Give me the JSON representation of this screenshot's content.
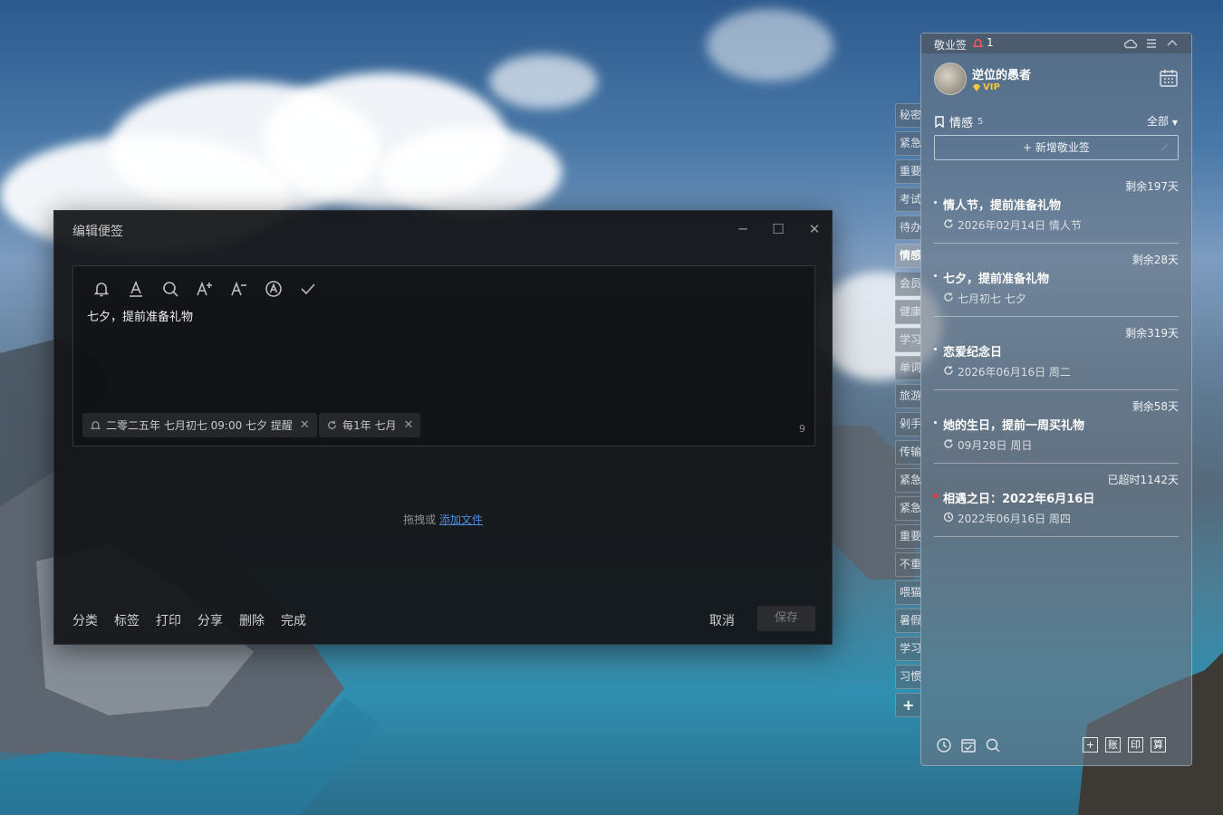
{
  "editor": {
    "title": "编辑便签",
    "note_text": "七夕，提前准备礼物",
    "reminder_chip": "二零二五年 七月初七 09:00 七夕 提醒",
    "repeat_chip": "每1年 七月",
    "char_count": "9",
    "drop_prefix": "拖拽或",
    "drop_link": "添加文件",
    "actions": [
      "分类",
      "标签",
      "打印",
      "分享",
      "删除",
      "完成"
    ],
    "cancel": "取消",
    "save": "保存",
    "toolbar_icons": [
      "bell-icon",
      "font-color-icon",
      "search-icon",
      "font-increase-icon",
      "font-decrease-icon",
      "auto-format-icon",
      "check-icon"
    ]
  },
  "side_tabs": {
    "items": [
      "秘密",
      "紧急",
      "重要",
      "考试",
      "待办",
      "情感",
      "会员",
      "健康",
      "学习",
      "单词",
      "旅游",
      "剁手",
      "传输",
      "紧急",
      "紧急",
      "重要",
      "不重",
      "喂猫",
      "暑假",
      "学习",
      "习惯"
    ],
    "active": "情感",
    "add": "+"
  },
  "panel": {
    "title": "敬业签",
    "bell_count": "1",
    "username": "逆位的愚者",
    "vip": "VIP",
    "category": "情感",
    "category_count": "5",
    "filter": "全部",
    "new_button": "新增敬业签",
    "notes": [
      {
        "remain": "剩余197天",
        "title": "情人节，提前准备礼物",
        "sub": "2026年02月14日 情人节",
        "icon": "repeat-icon",
        "dot": "white"
      },
      {
        "remain": "剩余28天",
        "title": "七夕，提前准备礼物",
        "sub": "七月初七 七夕",
        "icon": "repeat-icon",
        "dot": "white"
      },
      {
        "remain": "剩余319天",
        "title": "恋爱纪念日",
        "sub": "2026年06月16日 周二",
        "icon": "repeat-icon",
        "dot": "white"
      },
      {
        "remain": "剩余58天",
        "title": "她的生日，提前一周买礼物",
        "sub": "09月28日 周日",
        "icon": "repeat-icon",
        "dot": "white"
      },
      {
        "remain": "已超时1142天",
        "title": "相遇之日：2022年6月16日",
        "sub": "2022年06月16日 周四",
        "icon": "clock-icon",
        "dot": "red"
      }
    ],
    "footer_boxes": [
      "+",
      "账",
      "印",
      "算"
    ]
  },
  "colors": {
    "accent_link": "#4a8fe0",
    "vip_gold": "#f5c842",
    "overdue_dot": "#e53935"
  }
}
